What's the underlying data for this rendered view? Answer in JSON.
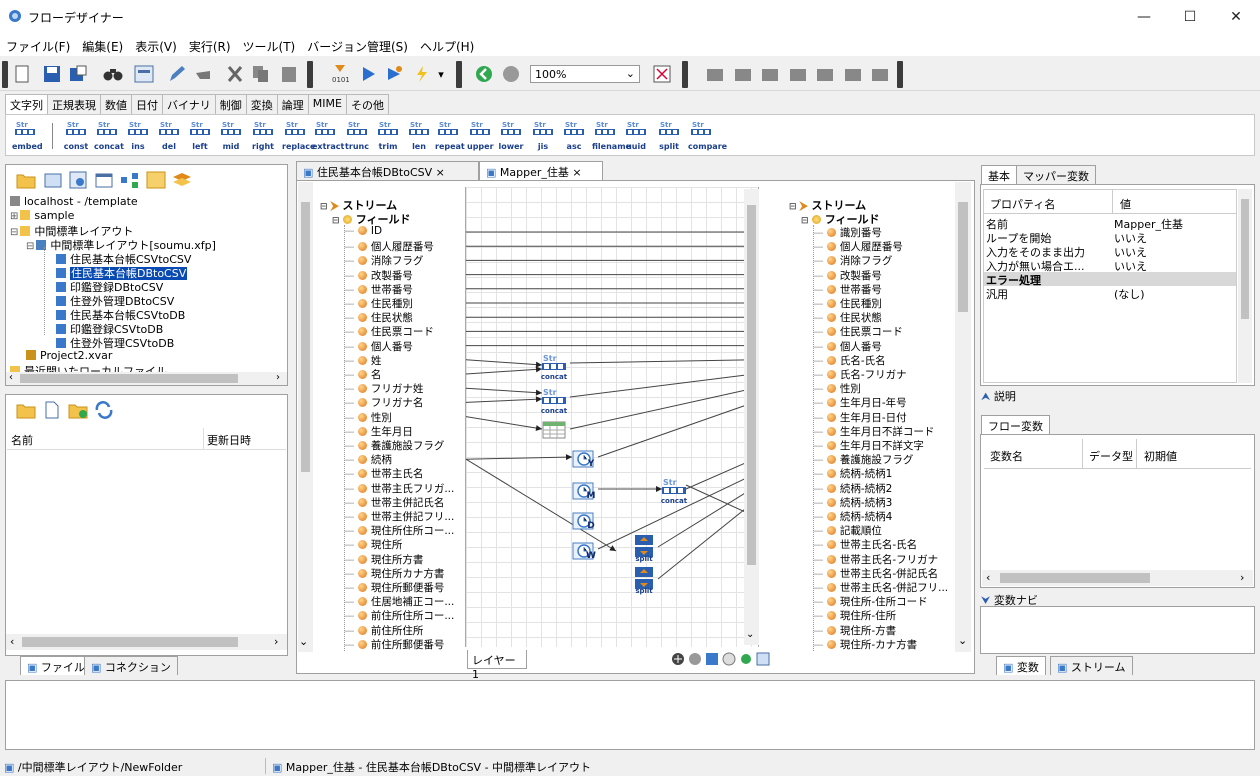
{
  "window": {
    "title": "フローデザイナー",
    "min": "—",
    "max": "☐",
    "close": "✕"
  },
  "menus": [
    "ファイル(F)",
    "編集(E)",
    "表示(V)",
    "実行(R)",
    "ツール(T)",
    "バージョン管理(S)",
    "ヘルプ(H)"
  ],
  "toolbar": {
    "zoom": "100%"
  },
  "function_tabs": [
    "文字列",
    "正規表現",
    "数値",
    "日付",
    "バイナリ",
    "制御",
    "変換",
    "論理",
    "MIME",
    "その他"
  ],
  "functions": [
    "embed",
    "const",
    "concat",
    "ins",
    "del",
    "left",
    "mid",
    "right",
    "replace",
    "extract",
    "trunc",
    "trim",
    "len",
    "repeat",
    "upper",
    "lower",
    "jis",
    "asc",
    "filename",
    "uuid",
    "split",
    "compare"
  ],
  "project_tree": {
    "root": "localhost - /template",
    "items": [
      "sample",
      "中間標準レイアウト",
      "中間標準レイアウト[soumu.xfp]",
      "住民基本台帳CSVtoCSV",
      "住民基本台帳DBtoCSV",
      "印鑑登録DBtoCSV",
      "住登外管理DBtoCSV",
      "住民基本台帳CSVtoDB",
      "印鑑登録CSVtoDB",
      "住登外管理CSVtoDB",
      "Project2.xvar",
      "最近開いたローカルファイル"
    ]
  },
  "file_list": {
    "col_name": "名前",
    "col_date": "更新日時"
  },
  "left_tabs": [
    "ファイル",
    "コネクション"
  ],
  "editor_tabs": [
    "住民基本台帳DBtoCSV",
    "Mapper_住基"
  ],
  "source": {
    "stream": "ストリーム",
    "field": "フィールド",
    "fields": [
      "ID",
      "個人履歴番号",
      "消除フラグ",
      "改製番号",
      "世帯番号",
      "住民種別",
      "住民状態",
      "住民票コード",
      "個人番号",
      "姓",
      "名",
      "フリガナ姓",
      "フリガナ名",
      "性別",
      "生年月日",
      "養護施設フラグ",
      "続柄",
      "世帯主氏名",
      "世帯主氏フリガ...",
      "世帯主併記氏名",
      "世帯主併記フリ...",
      "現住所住所コー...",
      "現住所",
      "現住所方書",
      "現住所カナ方書",
      "現住所郵便番号",
      "住居地補正コー...",
      "前住所住所コー...",
      "前住所住所",
      "前住所郵便番号"
    ]
  },
  "target": {
    "stream": "ストリーム",
    "field": "フィールド",
    "fields": [
      "識別番号",
      "個人履歴番号",
      "消除フラグ",
      "改製番号",
      "世帯番号",
      "住民種別",
      "住民状態",
      "住民票コード",
      "個人番号",
      "氏名-氏名",
      "氏名-フリガナ",
      "性別",
      "生年月日-年号",
      "生年月日-日付",
      "生年月日不詳コード",
      "生年月日不詳文字",
      "養護施設フラグ",
      "続柄-続柄1",
      "続柄-続柄2",
      "続柄-続柄3",
      "続柄-続柄4",
      "記載順位",
      "世帯主氏名-氏名",
      "世帯主氏名-フリガナ",
      "世帯主氏名-併記氏名",
      "世帯主氏名-併記フリ...",
      "現住所-住所コード",
      "現住所-住所",
      "現住所-方書",
      "現住所-カナ方書"
    ]
  },
  "mapping_nodes": {
    "concat": "concat",
    "split": "split",
    "y": "Y",
    "m": "M",
    "d": "D",
    "w": "W"
  },
  "layer_tab": "レイヤー1",
  "props": {
    "tabs": [
      "基本",
      "マッパー変数"
    ],
    "col_name": "プロパティ名",
    "col_value": "値",
    "rows": [
      [
        "名前",
        "Mapper_住基"
      ],
      [
        "ループを開始",
        "いいえ"
      ],
      [
        "入力をそのまま出力",
        "いいえ"
      ],
      [
        "入力が無い場合エ...",
        "いいえ"
      ]
    ],
    "section": "エラー処理",
    "rows2": [
      [
        "汎用",
        "(なし)"
      ]
    ]
  },
  "description_label": "説明",
  "flow_vars": {
    "tab": "フロー変数",
    "col_name": "変数名",
    "col_type": "データ型",
    "col_init": "初期値"
  },
  "var_navi": "変数ナビ",
  "right_tabs": [
    "変数",
    "ストリーム"
  ],
  "status": {
    "left": "/中間標準レイアウト/NewFolder",
    "right": "Mapper_住基 - 住民基本台帳DBtoCSV - 中間標準レイアウト"
  }
}
